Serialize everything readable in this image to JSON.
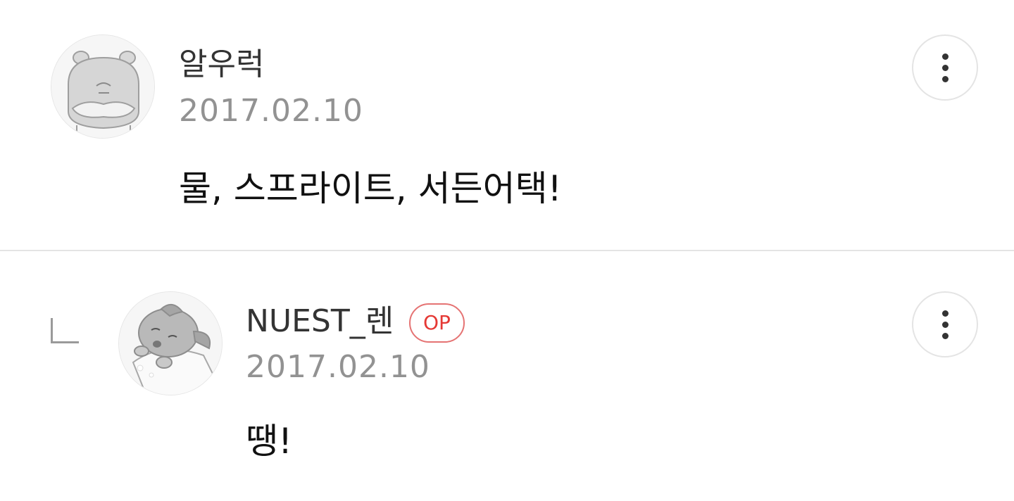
{
  "comments": [
    {
      "avatar": "hamster-avatar",
      "username": "알우럭",
      "date": "2017.02.10",
      "text": "물, 스프라이트, 서든어택!",
      "more_icon": "vertical-ellipsis-icon"
    },
    {
      "avatar": "dog-avatar",
      "reply_icon": "reply-corner-icon",
      "username": "NUEST_렌",
      "badge": "OP",
      "date": "2017.02.10",
      "text": "땡!",
      "more_icon": "vertical-ellipsis-icon"
    }
  ],
  "colors": {
    "divider": "#e4e4e4",
    "badge": "#e53935",
    "date": "#929292"
  }
}
